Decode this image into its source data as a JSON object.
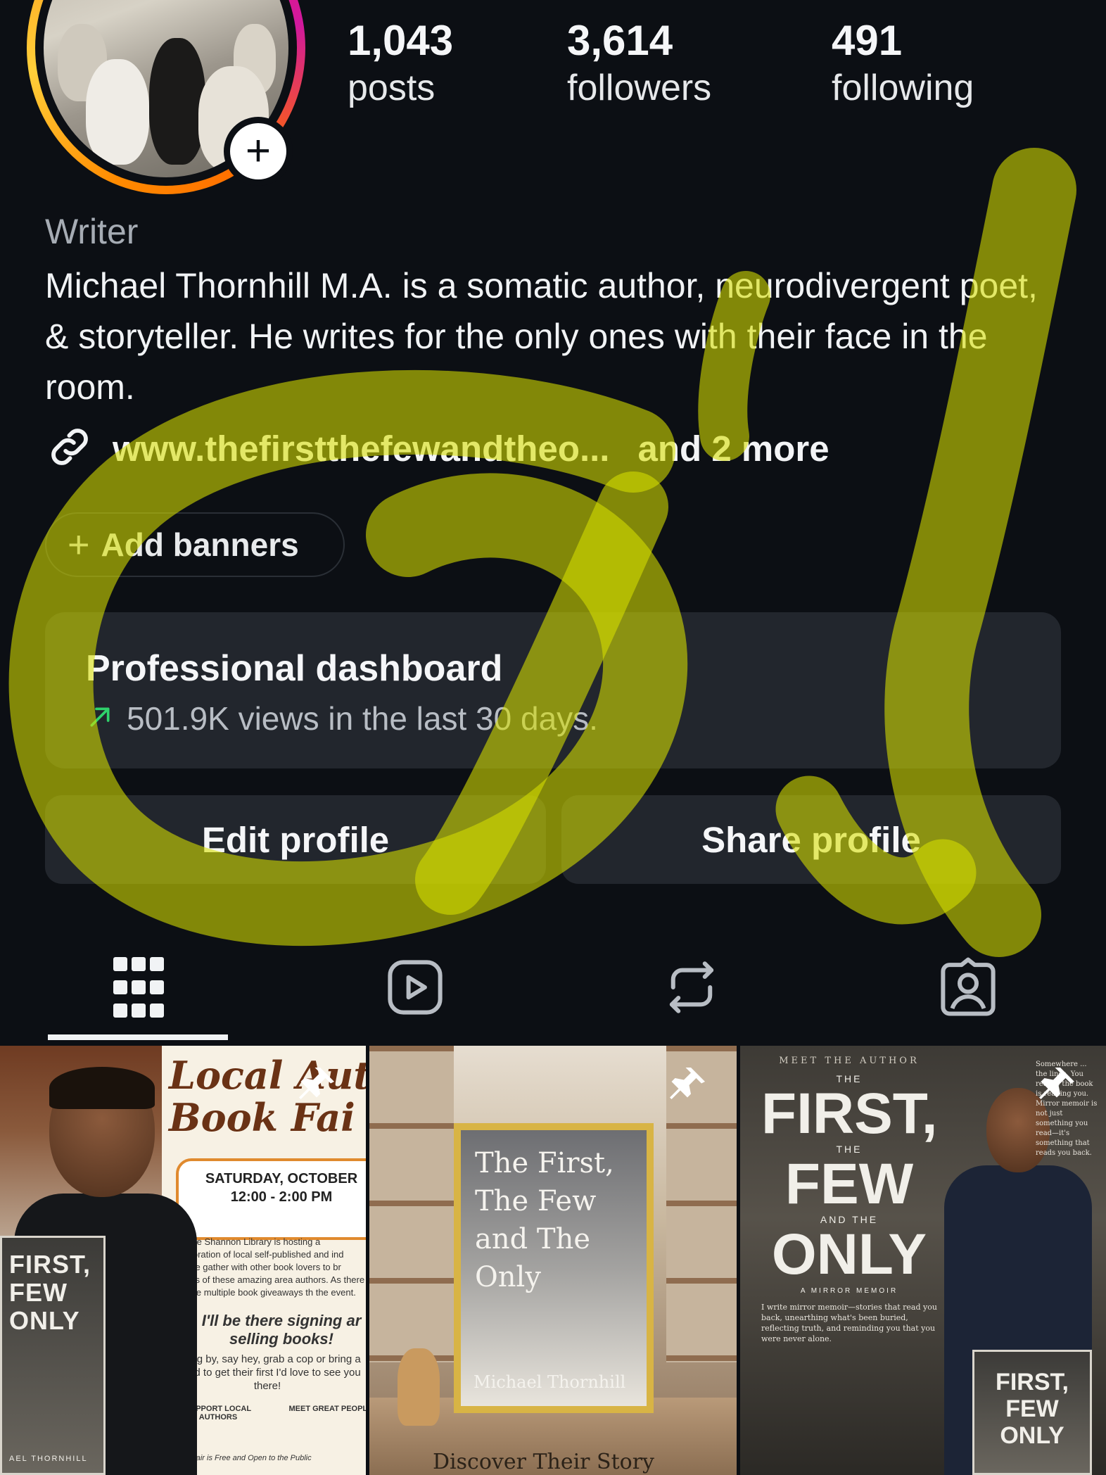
{
  "profile": {
    "stats": {
      "posts": {
        "value": "1,043",
        "label": "posts"
      },
      "followers": {
        "value": "3,614",
        "label": "followers"
      },
      "following": {
        "value": "491",
        "label": "following"
      }
    },
    "category": "Writer",
    "bio": "Michael Thornhill M.A. is a somatic author, neurodivergent poet, & storyteller. He writes for the only ones with their face in the room.",
    "link": {
      "url": "www.thefirstthefewandtheo...",
      "more": "and 2 more"
    },
    "add_banners_label": "Add banners"
  },
  "dashboard": {
    "title": "Professional dashboard",
    "subtitle": "501.9K views in the last 30 days."
  },
  "buttons": {
    "edit_profile": "Edit profile",
    "share_profile": "Share profile"
  },
  "tabs": [
    {
      "name": "posts-grid",
      "icon": "grid-icon",
      "selected": true
    },
    {
      "name": "reels",
      "icon": "reels-icon",
      "selected": false
    },
    {
      "name": "reposts",
      "icon": "repost-icon",
      "selected": false
    },
    {
      "name": "tagged",
      "icon": "tagged-icon",
      "selected": false
    }
  ],
  "grid": {
    "post1": {
      "headline_line1": "Local Auth",
      "headline_line2": "Book Fai",
      "date_line1": "SATURDAY, OCTOBER",
      "date_line2": "12:00 - 2:00 PM",
      "body": "Castle Shannon Library is hosting a celebration of local self-published and ind Come gather with other book lovers to br works of these amazing area authors. As there will be multiple book giveaways th the event.",
      "cta": "I'll be there signing ar selling books!",
      "sign": "Swing by, say hey, grab a cop or bring a friend to get their first I'd love to see you there!",
      "icon1": "SUPPORT LOCAL AUTHORS",
      "icon2": "MEET GREAT PEOPLE",
      "footer": "The Fair is Free and Open to the Public",
      "book_title": "FIRST, FEW ONLY",
      "book_author": "AEL THORNHILL"
    },
    "post2": {
      "cover_title": "The First, The Few and The Only",
      "cover_author": "Michael Thornhill",
      "bottom_text": "Discover Their Story"
    },
    "post3": {
      "meet": "MEET THE AUTHOR",
      "the1": "THE",
      "first": "FIRST,",
      "the2": "THE",
      "few": "FEW",
      "and_the": "AND THE",
      "only": "ONLY",
      "memoir": "A MIRROR MEMOIR",
      "desc": "I write mirror memoir—stories that read you back, unearthing what's been buried, reflecting truth, and reminding you that you were never alone.",
      "quote": "Somewhere ... the lines. You realize the book is reading you. Mirror memoir is not just something you read—it's something that reads you back.",
      "book": "FIRST, FEW ONLY"
    }
  },
  "colors": {
    "background": "#0c0f14",
    "card": "#22262d",
    "highlighter": "#d8e000",
    "trend_green": "#2fd26b"
  }
}
